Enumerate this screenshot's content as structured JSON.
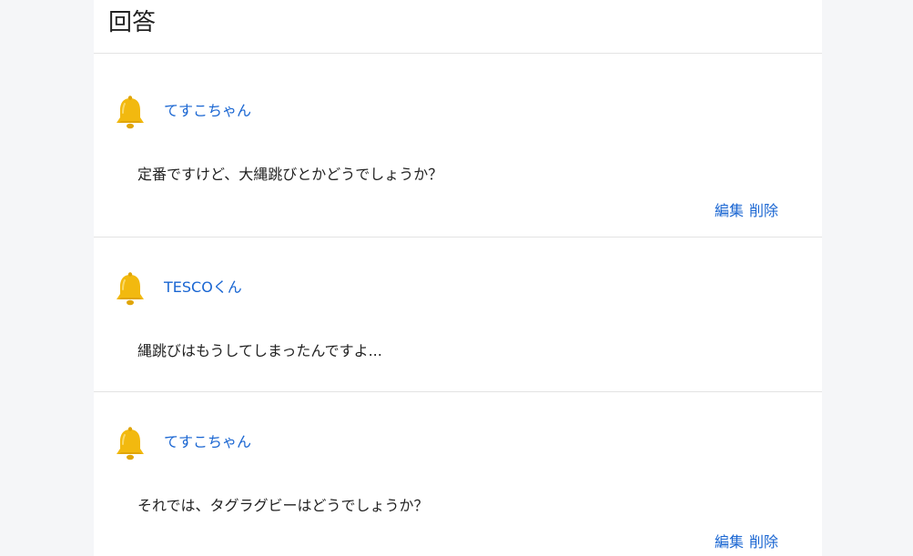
{
  "header": {
    "title": "回答"
  },
  "answers": [
    {
      "author": "てすこちゃん",
      "text": "定番ですけど、大縄跳びとかどうでしょうか？",
      "edit_label": "編集",
      "delete_label": "削除"
    },
    {
      "author": "TESCOくん",
      "text": "縄跳びはもうしてしまったんですよ..."
    },
    {
      "author": "てすこちゃん",
      "text": "それでは、タグラグビーはどうでしょうか？",
      "edit_label": "編集",
      "delete_label": "削除"
    }
  ],
  "icons": {
    "avatar": "bell-icon"
  },
  "colors": {
    "link": "#1a66d2",
    "bell": "#f2b90f",
    "background": "#f5f6f8"
  }
}
